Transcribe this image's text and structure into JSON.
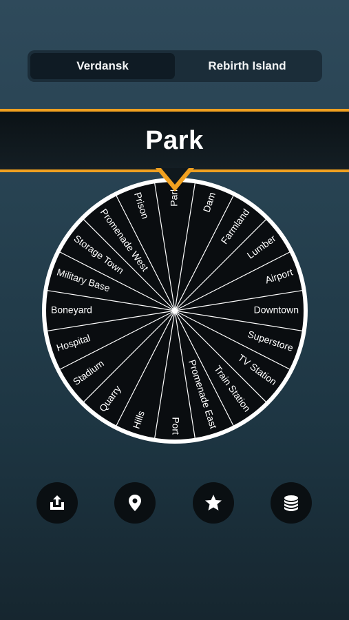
{
  "tabs": [
    {
      "label": "Verdansk",
      "active": true
    },
    {
      "label": "Rebirth Island",
      "active": false
    }
  ],
  "result": "Park",
  "wheel": {
    "segments": [
      "Park",
      "Dam",
      "Farmland",
      "Lumber",
      "Airport",
      "Downtown",
      "Superstore",
      "TV Station",
      "Train Station",
      "Promenade East",
      "Port",
      "Hills",
      "Quarry",
      "Stadium",
      "Hospital",
      "Boneyard",
      "Military Base",
      "Storage Town",
      "Promenade West",
      "Prison"
    ]
  },
  "actions": [
    {
      "name": "share-button",
      "icon": "share-icon"
    },
    {
      "name": "location-button",
      "icon": "location-pin-icon"
    },
    {
      "name": "favorites-button",
      "icon": "star-icon"
    },
    {
      "name": "coins-button",
      "icon": "coin-stack-icon"
    }
  ],
  "colors": {
    "accent": "#f0a020",
    "banner": "#0b1216",
    "wheel": "#0a0d10",
    "button": "#0a0f12"
  }
}
